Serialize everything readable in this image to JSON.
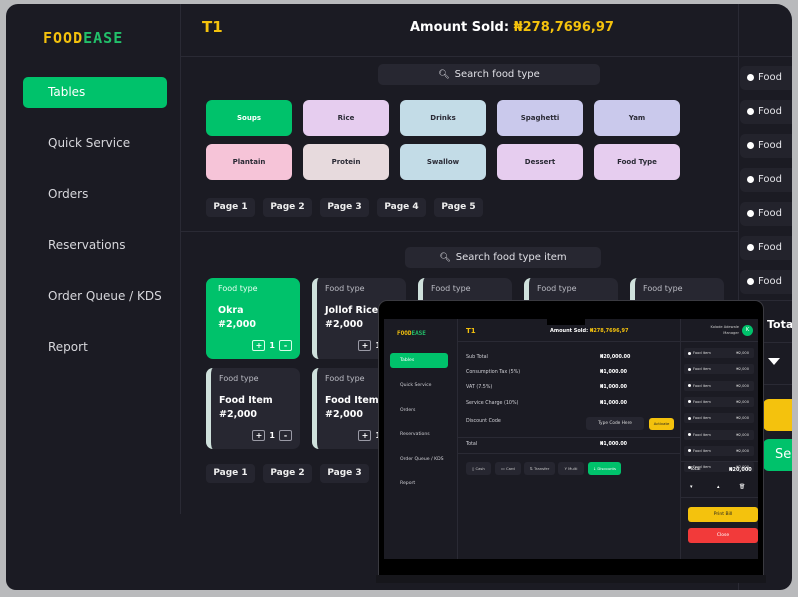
{
  "brand": {
    "part1": "FOOD",
    "part2": "EASE"
  },
  "sidebar": {
    "items": [
      {
        "label": "Tables",
        "active": true
      },
      {
        "label": "Quick Service"
      },
      {
        "label": "Orders"
      },
      {
        "label": "Reservations"
      },
      {
        "label": "Order Queue / KDS"
      },
      {
        "label": "Report"
      }
    ]
  },
  "header": {
    "table": "T1",
    "amount_label": "Amount Sold:",
    "amount_value": "₦278,7696,97"
  },
  "food_type_search": {
    "placeholder": "Search food type"
  },
  "categories": [
    {
      "label": "Soups",
      "color": "#00c26b"
    },
    {
      "label": "Rice",
      "color": "#e6cdef"
    },
    {
      "label": "Drinks",
      "color": "#c3dce7"
    },
    {
      "label": "Spaghetti",
      "color": "#cac9ec"
    },
    {
      "label": "Yam",
      "color": "#cac9ec"
    },
    {
      "label": "Plantain",
      "color": "#f6c4d8"
    },
    {
      "label": "Protein",
      "color": "#e7dadd"
    },
    {
      "label": "Swallow",
      "color": "#c3dce7"
    },
    {
      "label": "Dessert",
      "color": "#e6cdef"
    },
    {
      "label": "Food Type",
      "color": "#e6cdef"
    }
  ],
  "category_pages": [
    "Page 1",
    "Page 2",
    "Page 3",
    "Page 4",
    "Page 5"
  ],
  "item_search": {
    "placeholder": "Search food type item"
  },
  "items": [
    {
      "type": "Food type",
      "name": "Okra",
      "price": "#2,000",
      "qty": "1",
      "selected": true
    },
    {
      "type": "Food type",
      "name": "Jollof Rice",
      "price": "#2,000",
      "qty": "1"
    },
    {
      "type": "Food type",
      "name": "",
      "price": "",
      "qty": ""
    },
    {
      "type": "Food type",
      "name": "",
      "price": "",
      "qty": ""
    },
    {
      "type": "Food type",
      "name": "",
      "price": "",
      "qty": ""
    },
    {
      "type": "Food type",
      "name": "Food Item",
      "price": "#2,000",
      "qty": "1"
    },
    {
      "type": "Food type",
      "name": "Food Item",
      "price": "#2,000",
      "qty": "1"
    }
  ],
  "item_pages": [
    "Page 1",
    "Page 2",
    "Page 3"
  ],
  "order_panel": {
    "items": [
      "Food",
      "Food",
      "Food",
      "Food",
      "Food",
      "Food",
      "Food"
    ],
    "total_label": "Total",
    "print_label": "",
    "send_label": "Se"
  },
  "laptop": {
    "user_name": "Kolade Adewale",
    "user_role": "Manager",
    "avatar_initial": "K",
    "summary": [
      {
        "label": "Sub Total",
        "value": "₦20,000.00"
      },
      {
        "label": "Consumption Tax (5%)",
        "value": "₦1,000.00"
      },
      {
        "label": "VAT (7.5%)",
        "value": "₦1,000.00"
      },
      {
        "label": "Service Charge (10%)",
        "value": "₦1,000.00"
      }
    ],
    "discount_label": "Discount Code",
    "discount_placeholder": "Type Code Here",
    "activate_label": "Activate",
    "total_label": "Total",
    "total_value": "₦1,000.00",
    "payments": [
      "Cash",
      "Card",
      "Transfer",
      "Multi",
      "Discounts"
    ],
    "order_items": [
      {
        "name": "Food item",
        "price": "₦2,000"
      },
      {
        "name": "Food item",
        "price": "₦2,000"
      },
      {
        "name": "Food item",
        "price": "₦2,000"
      },
      {
        "name": "Food item",
        "price": "₦2,000"
      },
      {
        "name": "Food item",
        "price": "₦2,000"
      },
      {
        "name": "Food item",
        "price": "₦2,000"
      },
      {
        "name": "Food item",
        "price": "₦2,000"
      },
      {
        "name": "Food item",
        "price": "₦2,000"
      }
    ],
    "order_total_label": "Total",
    "order_total_value": "₦20,000",
    "print_label": "Print Bill",
    "close_label": "Close"
  },
  "colors": {
    "accent_green": "#00c26b",
    "accent_yellow": "#f4c20d",
    "danger_red": "#f23a3a",
    "background": "#1b1b23"
  }
}
